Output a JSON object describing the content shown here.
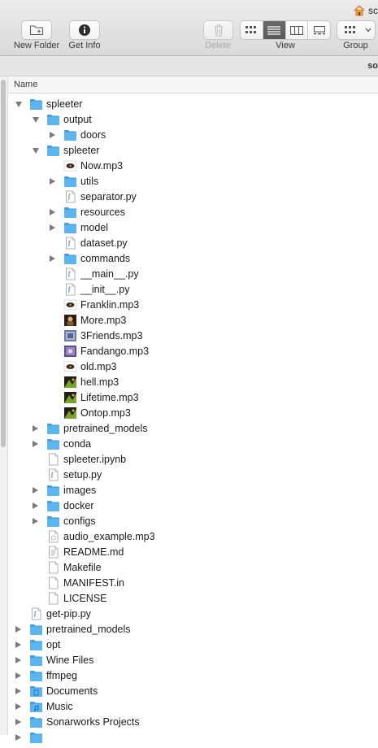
{
  "toolbar": {
    "new_folder_label": "New Folder",
    "get_info_label": "Get Info",
    "delete_label": "Delete",
    "view_label": "View",
    "group_label": "Group",
    "path_text": "sc"
  },
  "subbar": {
    "text": "so"
  },
  "columns": {
    "name": "Name"
  },
  "colors": {
    "folder": "#5bb5ee",
    "folder_dark": "#3d9fe0",
    "active_segment": "#636363"
  },
  "items": [
    {
      "label": "spleeter",
      "depth": 0,
      "type": "folder",
      "disclosure": "open"
    },
    {
      "label": "output",
      "depth": 1,
      "type": "folder",
      "disclosure": "open"
    },
    {
      "label": "doors",
      "depth": 2,
      "type": "folder",
      "disclosure": "closed"
    },
    {
      "label": "spleeter",
      "depth": 1,
      "type": "folder",
      "disclosure": "open"
    },
    {
      "label": "Now.mp3",
      "depth": 2,
      "type": "audio-dark",
      "disclosure": "none"
    },
    {
      "label": "utils",
      "depth": 2,
      "type": "folder",
      "disclosure": "closed"
    },
    {
      "label": "separator.py",
      "depth": 2,
      "type": "python",
      "disclosure": "none"
    },
    {
      "label": "resources",
      "depth": 2,
      "type": "folder",
      "disclosure": "closed"
    },
    {
      "label": "model",
      "depth": 2,
      "type": "folder",
      "disclosure": "closed"
    },
    {
      "label": "dataset.py",
      "depth": 2,
      "type": "python",
      "disclosure": "none"
    },
    {
      "label": "commands",
      "depth": 2,
      "type": "folder",
      "disclosure": "closed"
    },
    {
      "label": "__main__.py",
      "depth": 2,
      "type": "python",
      "disclosure": "none"
    },
    {
      "label": "__init__.py",
      "depth": 2,
      "type": "python",
      "disclosure": "none"
    },
    {
      "label": "Franklin.mp3",
      "depth": 2,
      "type": "audio-dark",
      "disclosure": "none"
    },
    {
      "label": "More.mp3",
      "depth": 2,
      "type": "audio-art-portrait",
      "disclosure": "none"
    },
    {
      "label": "3Friends.mp3",
      "depth": 2,
      "type": "audio-art-blue",
      "disclosure": "none"
    },
    {
      "label": "Fandango.mp3",
      "depth": 2,
      "type": "audio-art-purple",
      "disclosure": "none"
    },
    {
      "label": "old.mp3",
      "depth": 2,
      "type": "audio-dark",
      "disclosure": "none"
    },
    {
      "label": "hell.mp3",
      "depth": 2,
      "type": "audio-art-green",
      "disclosure": "none"
    },
    {
      "label": "Lifetime.mp3",
      "depth": 2,
      "type": "audio-art-green",
      "disclosure": "none"
    },
    {
      "label": "Ontop.mp3",
      "depth": 2,
      "type": "audio-art-green",
      "disclosure": "none"
    },
    {
      "label": "pretrained_models",
      "depth": 1,
      "type": "folder",
      "disclosure": "closed"
    },
    {
      "label": "conda",
      "depth": 1,
      "type": "folder",
      "disclosure": "closed"
    },
    {
      "label": "spleeter.ipynb",
      "depth": 1,
      "type": "document",
      "disclosure": "none"
    },
    {
      "label": "setup.py",
      "depth": 1,
      "type": "python",
      "disclosure": "none"
    },
    {
      "label": "images",
      "depth": 1,
      "type": "folder",
      "disclosure": "closed"
    },
    {
      "label": "docker",
      "depth": 1,
      "type": "folder",
      "disclosure": "closed"
    },
    {
      "label": "configs",
      "depth": 1,
      "type": "folder",
      "disclosure": "closed"
    },
    {
      "label": "audio_example.mp3",
      "depth": 1,
      "type": "audio-generic",
      "disclosure": "none"
    },
    {
      "label": "README.md",
      "depth": 1,
      "type": "text",
      "disclosure": "none"
    },
    {
      "label": "Makefile",
      "depth": 1,
      "type": "document",
      "disclosure": "none"
    },
    {
      "label": "MANIFEST.in",
      "depth": 1,
      "type": "document",
      "disclosure": "none"
    },
    {
      "label": "LICENSE",
      "depth": 1,
      "type": "document",
      "disclosure": "none"
    },
    {
      "label": "get-pip.py",
      "depth": 0,
      "type": "python",
      "disclosure": "none"
    },
    {
      "label": "pretrained_models",
      "depth": 0,
      "type": "folder",
      "disclosure": "closed"
    },
    {
      "label": "opt",
      "depth": 0,
      "type": "folder",
      "disclosure": "closed"
    },
    {
      "label": "Wine Files",
      "depth": 0,
      "type": "folder",
      "disclosure": "closed"
    },
    {
      "label": "ffmpeg",
      "depth": 0,
      "type": "folder",
      "disclosure": "closed"
    },
    {
      "label": "Documents",
      "depth": 0,
      "type": "folder-documents",
      "disclosure": "closed"
    },
    {
      "label": "Music",
      "depth": 0,
      "type": "folder-music",
      "disclosure": "closed"
    },
    {
      "label": "Sonarworks Projects",
      "depth": 0,
      "type": "folder",
      "disclosure": "closed"
    },
    {
      "label": "",
      "depth": 0,
      "type": "folder",
      "disclosure": "closed"
    }
  ]
}
